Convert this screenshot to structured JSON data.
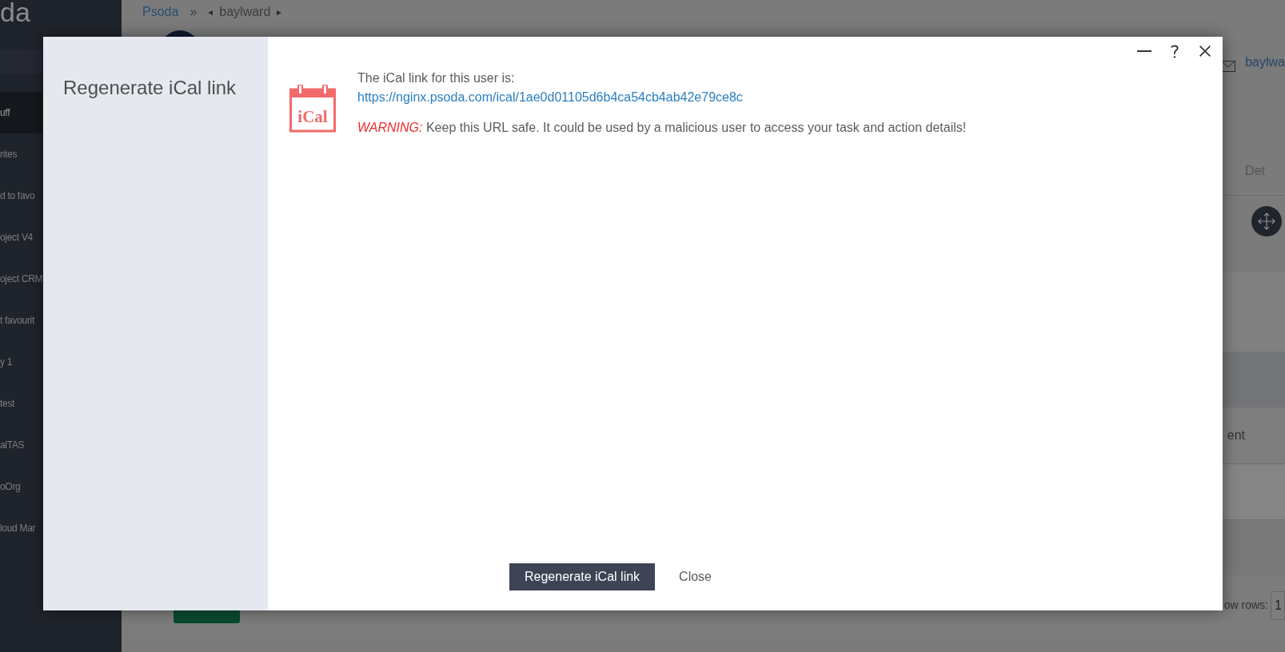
{
  "sidebar": {
    "logo": "da",
    "items": [
      {
        "label": "uff",
        "selected": true
      },
      {
        "label": "rites",
        "selected": false
      },
      {
        "label": "d to favo",
        "selected": false
      },
      {
        "label": "oject V4",
        "selected": false
      },
      {
        "label": "oject CRM",
        "selected": false
      },
      {
        "label": "t favourit",
        "selected": false
      },
      {
        "label": "y 1",
        "selected": false
      },
      {
        "label": "test",
        "selected": false
      },
      {
        "label": "alTAS",
        "selected": false
      },
      {
        "label": "oOrg",
        "selected": false
      },
      {
        "label": "loud Mar",
        "selected": false
      }
    ]
  },
  "breadcrumb": {
    "root": "Psoda",
    "separator": "»",
    "prev": "◂",
    "current": "baylward",
    "next": "▸"
  },
  "page": {
    "user_link": "baylwa",
    "tab": "Det",
    "column_text": "ent",
    "rows_label": "ow rows:",
    "rows_value": "1"
  },
  "dialog": {
    "title": "Regenerate iCal link",
    "icon_label": "iCal",
    "intro": "The iCal link for this user is:",
    "link": "https://nginx.psoda.com/ical/1ae0d01105d6b4ca54cb4ab42e79ce8c",
    "warning": "*WARNING:* Keep this URL safe. It could be used by a malicious user to access your task and action details!",
    "buttons": [
      {
        "label": "Regenerate iCal link",
        "kind": "primary"
      },
      {
        "label": "Close",
        "kind": "link"
      }
    ]
  }
}
